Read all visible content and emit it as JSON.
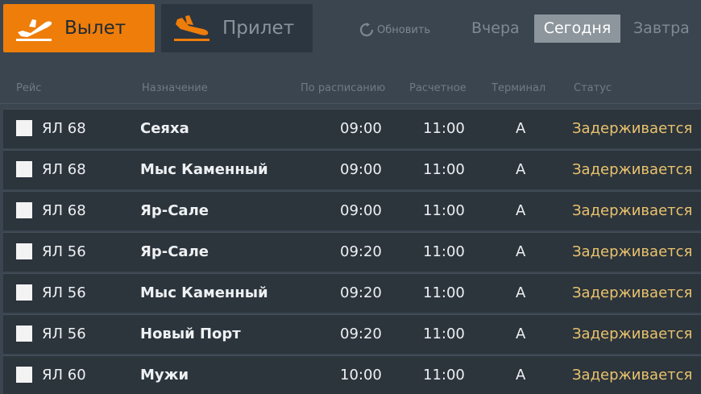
{
  "tabs": {
    "departure_label": "Вылет",
    "arrival_label": "Прилет"
  },
  "refresh_label": "Обновить",
  "days": {
    "yesterday": "Вчера",
    "today": "Сегодня",
    "tomorrow": "Завтра",
    "selected": "today"
  },
  "columns": {
    "flight": "Рейс",
    "destination": "Назначение",
    "scheduled": "По расписанию",
    "estimated": "Расчетное",
    "terminal": "Терминал",
    "status": "Статус"
  },
  "colors": {
    "accent": "#ee7d0a",
    "status_delayed": "#e9c36d",
    "row_bg": "#2c343c",
    "page_bg": "#3a4550"
  },
  "flights": [
    {
      "flight": "ЯЛ 68",
      "destination": "Сеяха",
      "scheduled": "09:00",
      "estimated": "11:00",
      "terminal": "А",
      "status": "Задерживается"
    },
    {
      "flight": "ЯЛ 68",
      "destination": "Мыс Каменный",
      "scheduled": "09:00",
      "estimated": "11:00",
      "terminal": "А",
      "status": "Задерживается"
    },
    {
      "flight": "ЯЛ 68",
      "destination": "Яр-Сале",
      "scheduled": "09:00",
      "estimated": "11:00",
      "terminal": "А",
      "status": "Задерживается"
    },
    {
      "flight": "ЯЛ 56",
      "destination": "Яр-Сале",
      "scheduled": "09:20",
      "estimated": "11:00",
      "terminal": "А",
      "status": "Задерживается"
    },
    {
      "flight": "ЯЛ 56",
      "destination": "Мыс Каменный",
      "scheduled": "09:20",
      "estimated": "11:00",
      "terminal": "А",
      "status": "Задерживается"
    },
    {
      "flight": "ЯЛ 56",
      "destination": "Новый Порт",
      "scheduled": "09:20",
      "estimated": "11:00",
      "terminal": "А",
      "status": "Задерживается"
    },
    {
      "flight": "ЯЛ 60",
      "destination": "Мужи",
      "scheduled": "10:00",
      "estimated": "11:00",
      "terminal": "А",
      "status": "Задерживается"
    }
  ]
}
